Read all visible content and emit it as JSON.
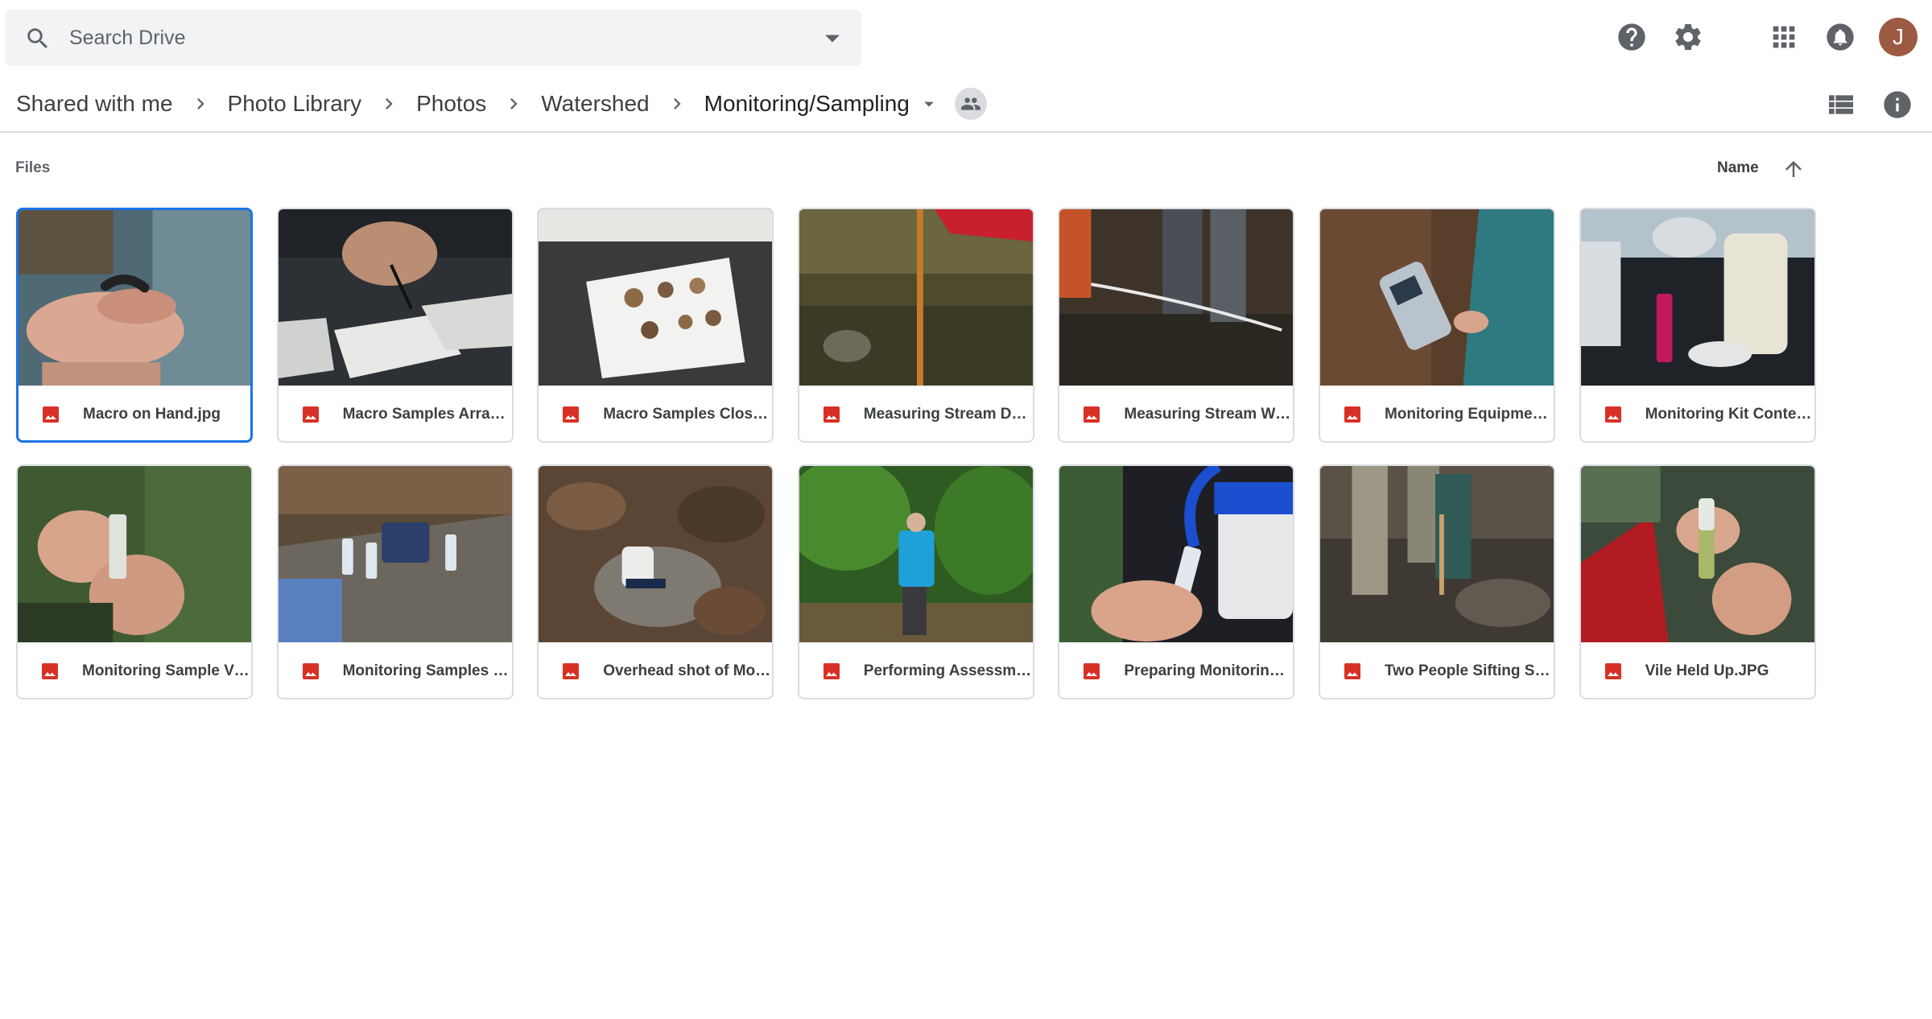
{
  "search": {
    "placeholder": "Search Drive"
  },
  "breadcrumb": [
    "Shared with me",
    "Photo Library",
    "Photos",
    "Watershed",
    "Monitoring/Sampling"
  ],
  "avatar_initial": "J",
  "files_heading": "Files",
  "sort": {
    "label": "Name",
    "direction": "ascending"
  },
  "icons": {
    "search": "search-icon",
    "dropdown": "chevron-down-icon",
    "help": "help-icon",
    "settings": "gear-icon",
    "apps": "apps-grid-icon",
    "notifications": "bell-icon",
    "list_view": "list-view-icon",
    "info": "info-icon",
    "shared": "people-icon",
    "file_type": "image-file-icon"
  },
  "colors": {
    "accent": "#1a73e8",
    "image_icon": "#d93025",
    "avatar": "#9c5a42"
  },
  "files": [
    {
      "name": "Macro on Hand.jpg",
      "selected": true
    },
    {
      "name": "Macro Samples Arranged on Tray.jpg"
    },
    {
      "name": "Macro Samples Close Up.jpg"
    },
    {
      "name": "Measuring Stream Depth.jpg"
    },
    {
      "name": "Measuring Stream Width.jpg"
    },
    {
      "name": "Monitoring Equipment.jpg"
    },
    {
      "name": "Monitoring Kit Contents.jpg"
    },
    {
      "name": "Monitoring Sample Vial.jpg"
    },
    {
      "name": "Monitoring Samples Lined Up.jpg"
    },
    {
      "name": "Overhead shot of Monitoring Kit.jpg"
    },
    {
      "name": "Performing Assessment.jpg"
    },
    {
      "name": "Preparing Monitoring Sample.jpg"
    },
    {
      "name": "Two People Sifting Stream.jpg"
    },
    {
      "name": "Vile Held Up.JPG"
    }
  ]
}
